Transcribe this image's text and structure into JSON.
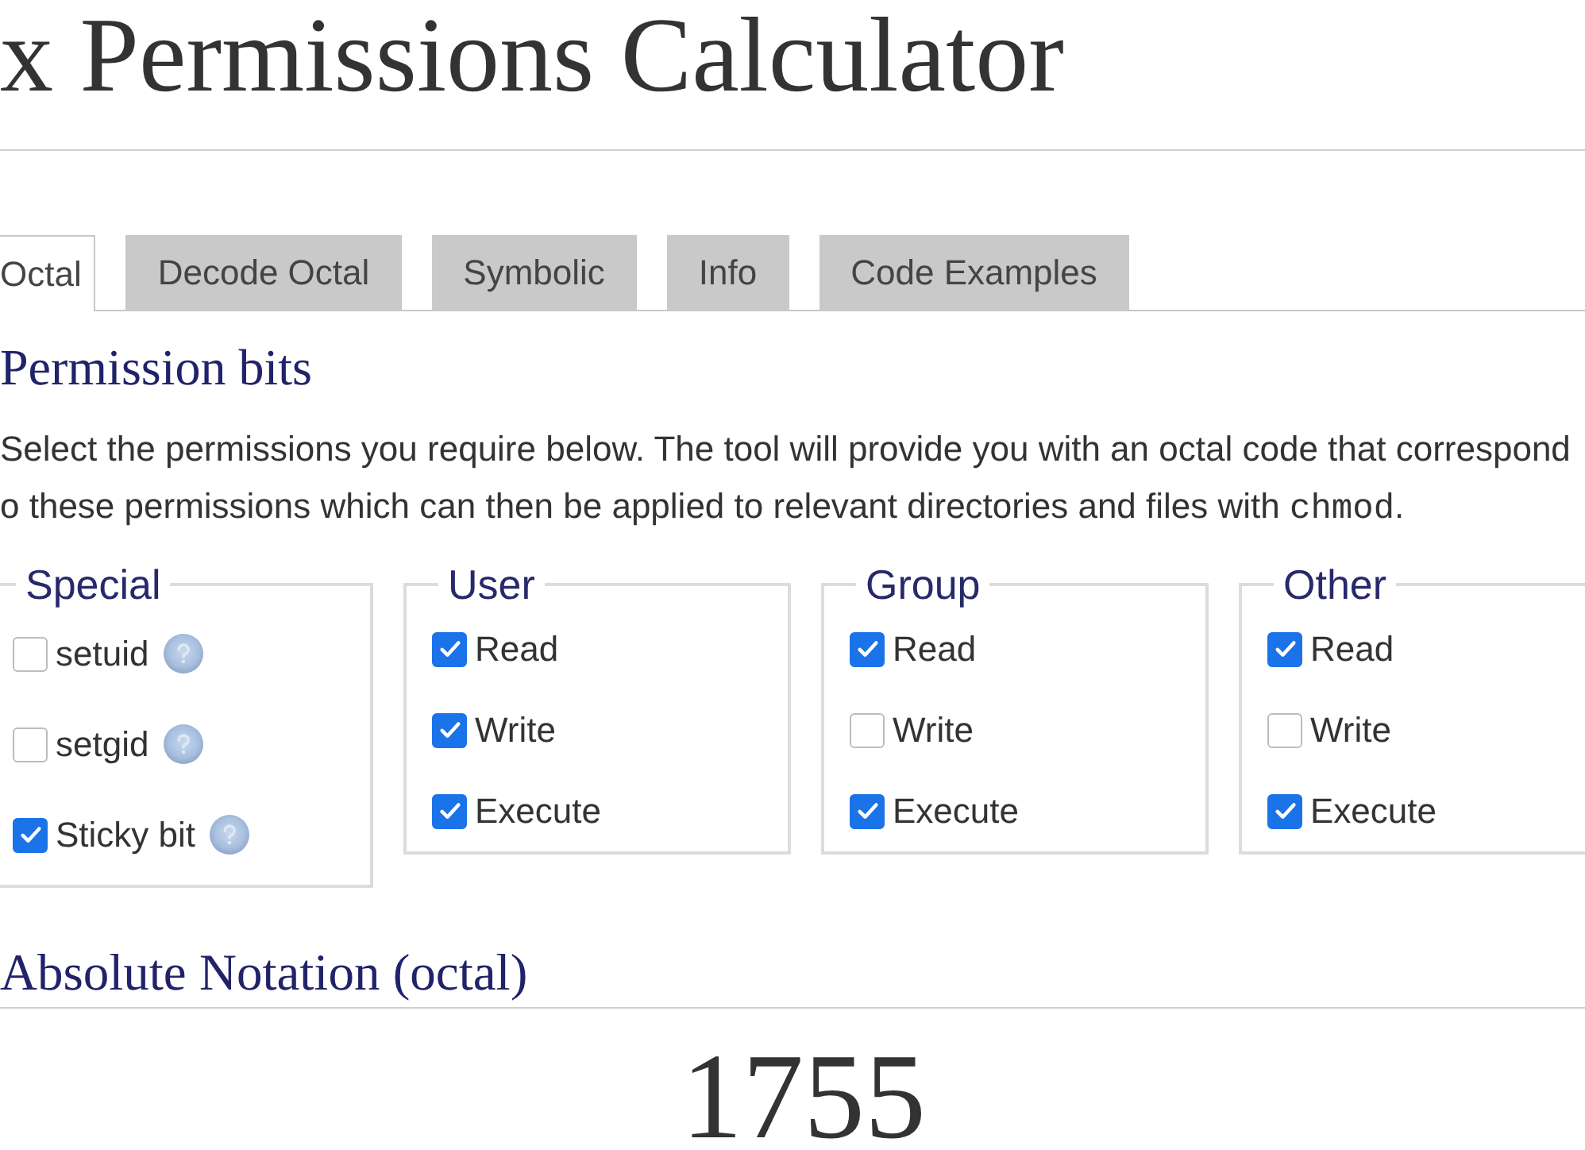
{
  "page_title": "x Permissions Calculator",
  "tabs": [
    {
      "label": "Octal",
      "selected": true
    },
    {
      "label": "Decode Octal",
      "selected": false
    },
    {
      "label": "Symbolic",
      "selected": false
    },
    {
      "label": "Info",
      "selected": false
    },
    {
      "label": "Code Examples",
      "selected": false
    }
  ],
  "permission_bits": {
    "heading": "Permission bits",
    "intro_lines": [
      [
        {
          "kind": "text",
          "text": "Select the permissions you require below. The tool will provide you with an octal code that correspond"
        }
      ],
      [
        {
          "kind": "text",
          "text": "o these permissions which can then be applied to relevant directories and files with "
        },
        {
          "kind": "code",
          "text": "chmod"
        },
        {
          "kind": "text",
          "text": "."
        }
      ]
    ],
    "groups": [
      {
        "legend": "Special",
        "options": [
          {
            "label": "setuid",
            "checked": false,
            "help": true
          },
          {
            "label": "setgid",
            "checked": false,
            "help": true
          },
          {
            "label": "Sticky bit",
            "checked": true,
            "help": true
          }
        ]
      },
      {
        "legend": "User",
        "options": [
          {
            "label": "Read",
            "checked": true,
            "help": false
          },
          {
            "label": "Write",
            "checked": true,
            "help": false
          },
          {
            "label": "Execute",
            "checked": true,
            "help": false
          }
        ]
      },
      {
        "legend": "Group",
        "options": [
          {
            "label": "Read",
            "checked": true,
            "help": false
          },
          {
            "label": "Write",
            "checked": false,
            "help": false
          },
          {
            "label": "Execute",
            "checked": true,
            "help": false
          }
        ]
      },
      {
        "legend": "Other",
        "options": [
          {
            "label": "Read",
            "checked": true,
            "help": false
          },
          {
            "label": "Write",
            "checked": false,
            "help": false
          },
          {
            "label": "Execute",
            "checked": true,
            "help": false
          }
        ]
      }
    ]
  },
  "absolute_notation": {
    "heading": "Absolute Notation (octal)",
    "value": "1755"
  }
}
